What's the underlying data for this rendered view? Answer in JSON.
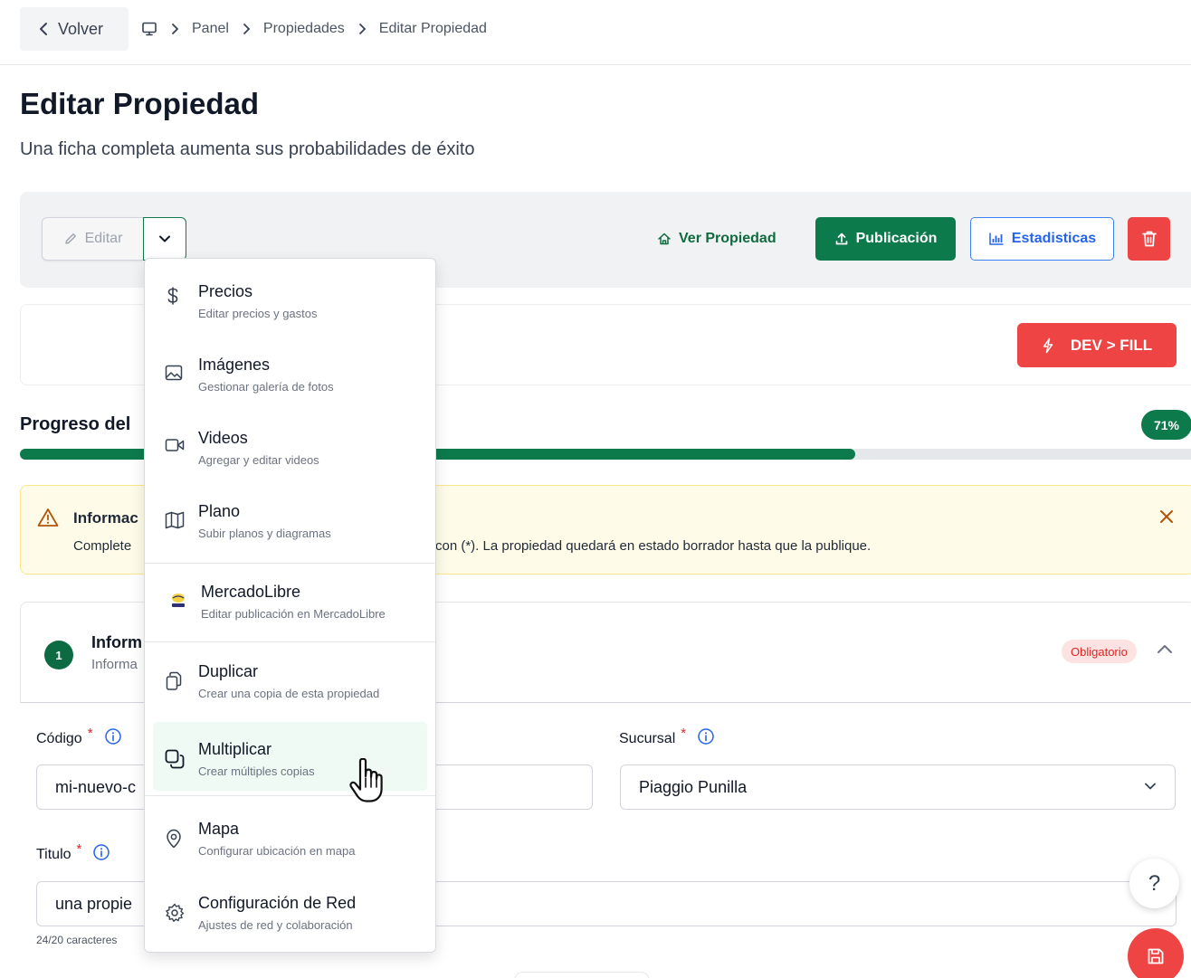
{
  "nav": {
    "back_label": "Volver",
    "breadcrumbs": [
      "Panel",
      "Propiedades",
      "Editar Propiedad"
    ]
  },
  "header": {
    "title": "Editar Propiedad",
    "subtitle": "Una ficha completa aumenta sus probabilidades de éxito"
  },
  "toolbar": {
    "edit_label": "Editar",
    "view_label": "Ver Propiedad",
    "publish_label": "Publicación",
    "stats_label": "Estadisticas"
  },
  "dev": {
    "fill_label": "DEV > FILL"
  },
  "progress": {
    "title_visible": "Progreso del",
    "percent_label": "71%",
    "fraction": 0.71
  },
  "alert": {
    "title_visible": "Informac",
    "text_left": "Complete",
    "text_right": "con (*). La propiedad quedará en estado borrador hasta que la publique."
  },
  "section": {
    "step": "1",
    "title_visible": "Inform",
    "subtitle_visible": "Informa",
    "required_badge": "Obligatorio"
  },
  "form": {
    "codigo_label": "Código",
    "codigo_value": "mi-nuevo-c",
    "sucursal_label": "Sucursal",
    "sucursal_value": "Piaggio Punilla",
    "titulo_label": "Titulo",
    "titulo_value": "una propie",
    "char_count": "24/20 caracteres"
  },
  "help_label": "?",
  "menu": {
    "items": [
      {
        "label": "Precios",
        "desc": "Editar precios y gastos",
        "icon": "dollar-icon"
      },
      {
        "label": "Imágenes",
        "desc": "Gestionar galería de fotos",
        "icon": "image-icon"
      },
      {
        "label": "Videos",
        "desc": "Agregar y editar videos",
        "icon": "video-icon"
      },
      {
        "label": "Plano",
        "desc": "Subir planos y diagramas",
        "icon": "map-plan-icon"
      },
      {
        "label": "MercadoLibre",
        "desc": "Editar publicación en MercadoLibre",
        "icon": "mercadolibre-logo-icon"
      },
      {
        "label": "Duplicar",
        "desc": "Crear una copia de esta propiedad",
        "icon": "copy-icon"
      },
      {
        "label": "Multiplicar",
        "desc": "Crear múltiples copias",
        "icon": "multiply-copies-icon",
        "highlighted": true
      },
      {
        "label": "Mapa",
        "desc": "Configurar ubicación en mapa",
        "icon": "location-pin-icon"
      },
      {
        "label": "Configuración de Red",
        "desc": "Ajustes de red y colaboración",
        "icon": "gear-icon"
      }
    ]
  },
  "colors": {
    "primary_green": "#0d7a4c",
    "danger_red": "#ef4444",
    "info_blue": "#2563eb",
    "alert_bg": "#fefce8",
    "highlight_bg": "#eefaf3"
  }
}
